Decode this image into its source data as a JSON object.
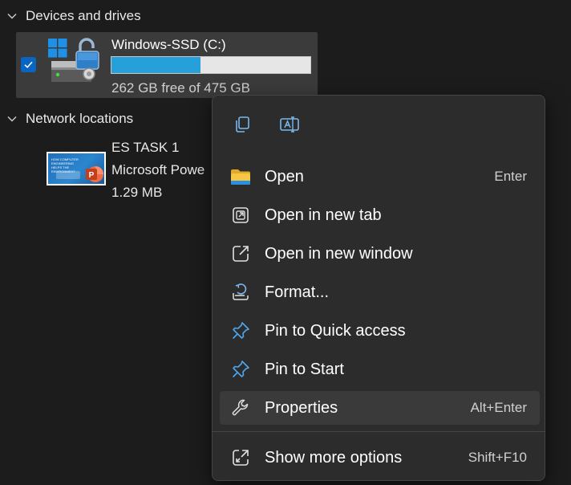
{
  "sections": {
    "devices_label": "Devices and drives",
    "network_label": "Network locations"
  },
  "drive": {
    "name": "Windows-SSD (C:)",
    "free_text": "262 GB free of 475 GB",
    "used_fraction": 0.448,
    "selected": true,
    "icon": "drive-bitlocker-icon"
  },
  "file": {
    "name": "ES TASK 1",
    "type": "Microsoft Powe",
    "size": "1.29 MB",
    "thumbnail_text": "HOW COMPUTER ENGINEERING HELPS THE ENVIRONMENT",
    "icon": "powerpoint-icon"
  },
  "context_menu": {
    "top_actions": [
      {
        "icon": "copy-icon"
      },
      {
        "icon": "rename-icon"
      }
    ],
    "items": [
      {
        "label": "Open",
        "shortcut": "Enter",
        "icon": "folder-icon"
      },
      {
        "label": "Open in new tab",
        "shortcut": "",
        "icon": "open-new-tab-icon"
      },
      {
        "label": "Open in new window",
        "shortcut": "",
        "icon": "open-new-window-icon"
      },
      {
        "label": "Format...",
        "shortcut": "",
        "icon": "format-icon"
      },
      {
        "label": "Pin to Quick access",
        "shortcut": "",
        "icon": "pin-icon"
      },
      {
        "label": "Pin to Start",
        "shortcut": "",
        "icon": "pin-icon"
      },
      {
        "label": "Properties",
        "shortcut": "Alt+Enter",
        "icon": "wrench-icon",
        "highlighted": true
      },
      {
        "label": "Show more options",
        "shortcut": "Shift+F10",
        "icon": "show-more-icon"
      }
    ]
  },
  "colors": {
    "background": "#1c1c1c",
    "menu_background": "#2c2c2c",
    "accent": "#26a0da",
    "checkbox": "#0a64c2"
  }
}
